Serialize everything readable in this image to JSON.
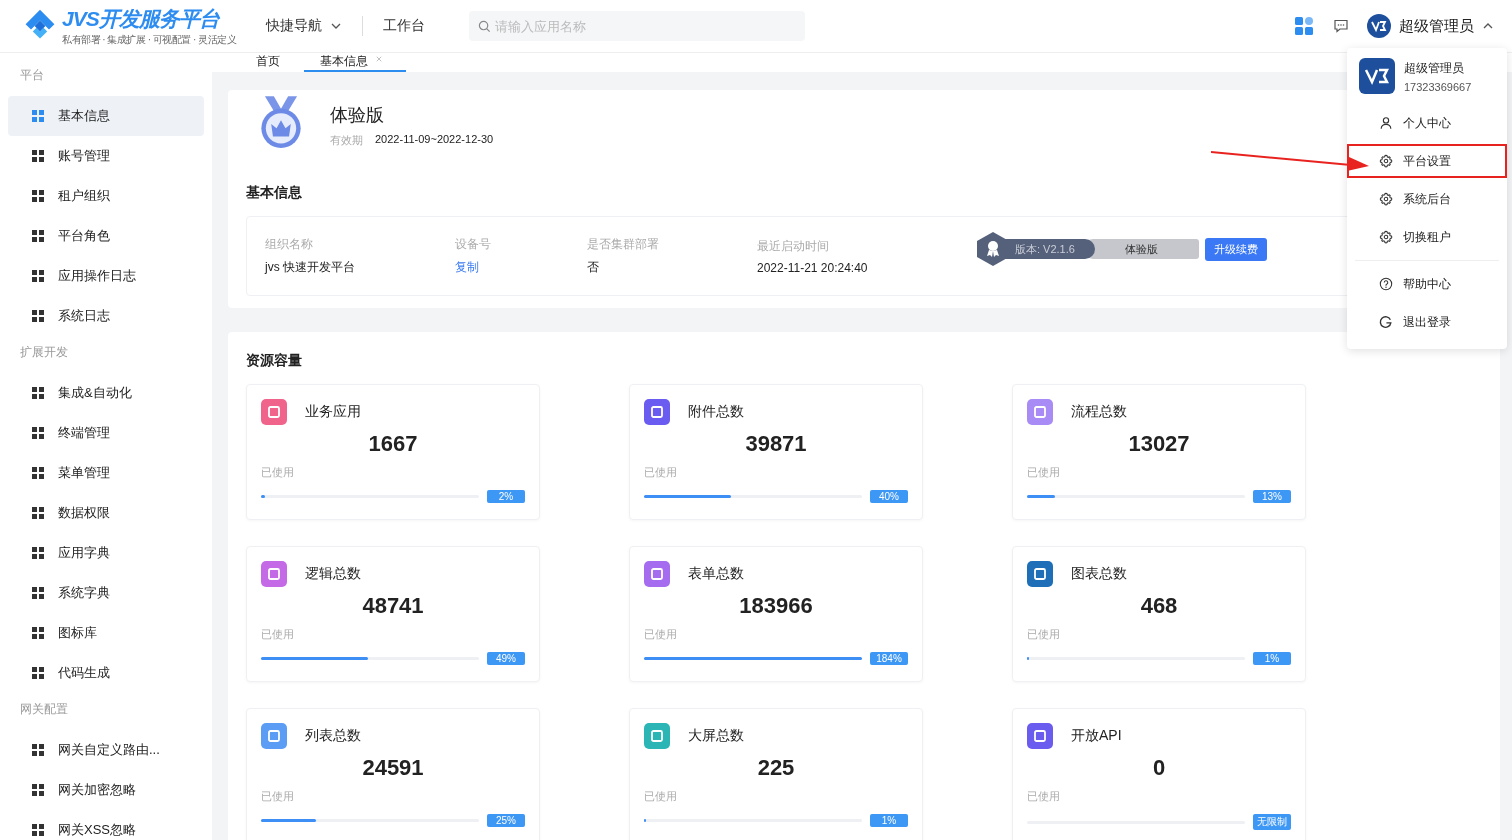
{
  "header": {
    "logo_title": "JVS开发服务平台",
    "logo_slogan": "私有部署 · 集成扩展 · 可视配置 · 灵活定义",
    "nav": [
      {
        "label": "快捷导航",
        "kind": "dropdown"
      },
      {
        "label": "工作台",
        "kind": "link"
      }
    ],
    "search": {
      "placeholder": "请输入应用名称"
    },
    "user": {
      "name": "超级管理员",
      "expanded": true
    }
  },
  "sidebar": {
    "groups": [
      {
        "title": "平台",
        "items": [
          {
            "label": "基本信息",
            "selected": true
          },
          {
            "label": "账号管理",
            "selected": false
          },
          {
            "label": "租户组织",
            "selected": false
          },
          {
            "label": "平台角色",
            "selected": false
          },
          {
            "label": "应用操作日志",
            "selected": false
          },
          {
            "label": "系统日志",
            "selected": false
          }
        ]
      },
      {
        "title": "扩展开发",
        "items": [
          {
            "label": "集成&自动化",
            "selected": false
          },
          {
            "label": "终端管理",
            "selected": false
          },
          {
            "label": "菜单管理",
            "selected": false
          },
          {
            "label": "数据权限",
            "selected": false
          },
          {
            "label": "应用字典",
            "selected": false
          },
          {
            "label": "系统字典",
            "selected": false
          },
          {
            "label": "图标库",
            "selected": false
          },
          {
            "label": "代码生成",
            "selected": false
          }
        ]
      },
      {
        "title": "网关配置",
        "items": [
          {
            "label": "网关自定义路由...",
            "selected": false
          },
          {
            "label": "网关加密忽略",
            "selected": false
          },
          {
            "label": "网关XSS忽略",
            "selected": false
          }
        ]
      }
    ]
  },
  "tabs": [
    {
      "label": "首页",
      "selected": false,
      "closable": false
    },
    {
      "label": "基本信息",
      "selected": true,
      "closable": true
    }
  ],
  "license": {
    "edition": "体验版",
    "validity_label": "有效期",
    "validity": "2022-11-09~2022-12-30"
  },
  "basic_info": {
    "title": "基本信息",
    "fields": [
      {
        "label": "组织名称",
        "value": "jvs 快速开发平台",
        "kind": "text"
      },
      {
        "label": "设备号",
        "value": "复制",
        "kind": "link"
      },
      {
        "label": "是否集群部署",
        "value": "否",
        "kind": "text"
      },
      {
        "label": "最近启动时间",
        "value": "2022-11-21 20:24:40",
        "kind": "text"
      }
    ],
    "version": "版本: V2.1.6",
    "version_edition": "体验版",
    "upgrade_button": "升级续费"
  },
  "resources": {
    "title": "资源容量",
    "cards": [
      {
        "title": "业务应用",
        "count": "1667",
        "used_label": "已使用",
        "level": 0.02,
        "percent": "2%",
        "color": "#f0648c"
      },
      {
        "title": "附件总数",
        "count": "39871",
        "used_label": "已使用",
        "level": 0.4,
        "percent": "40%",
        "color": "#6a5cf0"
      },
      {
        "title": "流程总数",
        "count": "13027",
        "used_label": "已使用",
        "level": 0.13,
        "percent": "13%",
        "color": "#a98bf5"
      },
      {
        "title": "逻辑总数",
        "count": "48741",
        "used_label": "已使用",
        "level": 0.49,
        "percent": "49%",
        "color": "#c46ae6"
      },
      {
        "title": "表单总数",
        "count": "183966",
        "used_label": "已使用",
        "level": 1,
        "percent": "184%",
        "color": "#a56cf0"
      },
      {
        "title": "图表总数",
        "count": "468",
        "used_label": "已使用",
        "level": 0.01,
        "percent": "1%",
        "color": "#1f6fb8"
      },
      {
        "title": "列表总数",
        "count": "24591",
        "used_label": "已使用",
        "level": 0.25,
        "percent": "25%",
        "color": "#5b9cf5"
      },
      {
        "title": "大屏总数",
        "count": "225",
        "used_label": "已使用",
        "level": 0.01,
        "percent": "1%",
        "color": "#2bb5b5"
      },
      {
        "title": "开放API",
        "count": "0",
        "used_label": "已使用",
        "level": 0,
        "percent": "无限制",
        "color": "#6b5cf0"
      }
    ]
  },
  "user_menu": {
    "name": "超级管理员",
    "phone": "17323369667",
    "sections": [
      [
        {
          "label": "个人中心",
          "kind": "person",
          "highlighted": false
        },
        {
          "label": "平台设置",
          "kind": "gear",
          "highlighted": true
        },
        {
          "label": "系统后台",
          "kind": "gear",
          "highlighted": false
        },
        {
          "label": "切换租户",
          "kind": "gear",
          "highlighted": false
        }
      ],
      [
        {
          "label": "帮助中心",
          "kind": "help",
          "highlighted": false
        },
        {
          "label": "退出登录",
          "kind": "logout",
          "highlighted": false
        }
      ]
    ]
  }
}
